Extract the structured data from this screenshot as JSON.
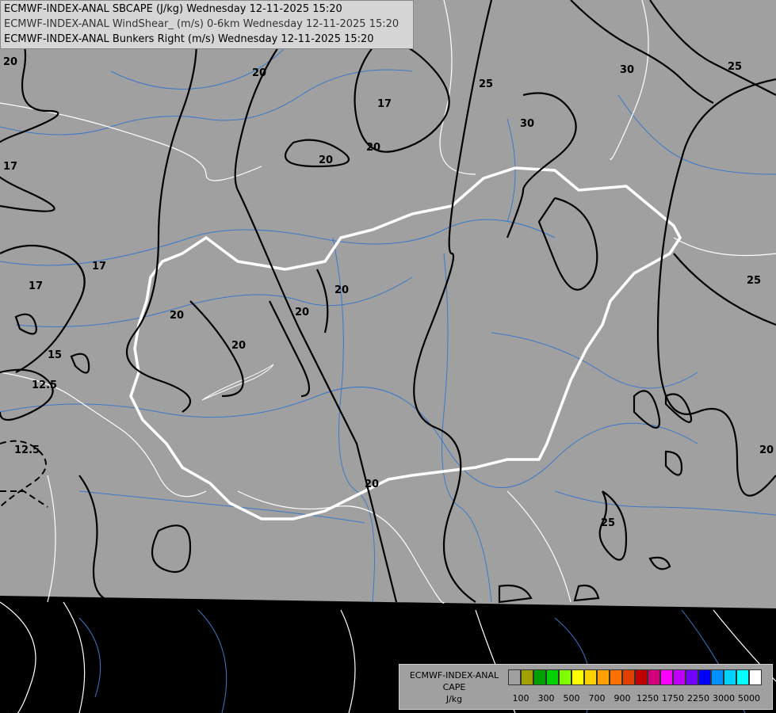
{
  "title_lines": [
    "ECMWF-INDEX-ANAL SBCAPE (J/kg) Wednesday 12-11-2025 15:20",
    "ECMWF-INDEX-ANAL WindShear_ (m/s) 0-6km Wednesday 12-11-2025 15:20",
    "ECMWF-INDEX-ANAL Bunkers Right (m/s) Wednesday 12-11-2025 15:20"
  ],
  "legend": {
    "model": "ECMWF-INDEX-ANAL",
    "variable": "CAPE",
    "unit": "J/kg",
    "colors": [
      "#a0a0a0",
      "#a0a000",
      "#00a000",
      "#00d000",
      "#80ff00",
      "#ffff00",
      "#ffd000",
      "#ffa000",
      "#ff7000",
      "#e04000",
      "#c00000",
      "#d0007a",
      "#ff00ff",
      "#c000ff",
      "#7000ff",
      "#0000ff",
      "#0090ff",
      "#00d0ff",
      "#00ffff",
      "#ffffff"
    ],
    "tick_labels": [
      "100",
      "300",
      "500",
      "700",
      "900",
      "1250",
      "1750",
      "2250",
      "3000",
      "5000"
    ]
  },
  "contour_labels": [
    "20",
    "17",
    "17",
    "17",
    "15",
    "12.5",
    "12.5",
    "20",
    "20",
    "20",
    "20",
    "20",
    "20",
    "17",
    "20",
    "25",
    "30",
    "30",
    "25",
    "25",
    "20",
    "25",
    "20"
  ],
  "colors": {
    "background": "#000000",
    "domain": "#a0a0a0",
    "borders": "#ffffff",
    "rivers": "#3a78c8",
    "contours": "#000000"
  }
}
